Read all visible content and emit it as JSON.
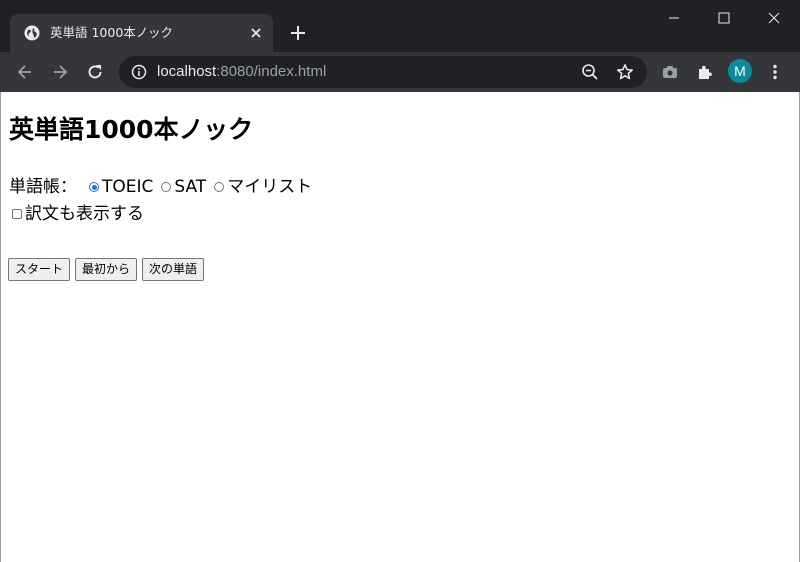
{
  "browser": {
    "tab_title": "英単語 1000本ノック",
    "url_host": "localhost",
    "url_rest": ":8080/index.html",
    "profile_initial": "M"
  },
  "page": {
    "heading": "英単語1000本ノック",
    "vocab_label": "単語帳：",
    "options": [
      {
        "label": "TOEIC",
        "checked": true
      },
      {
        "label": "SAT",
        "checked": false
      },
      {
        "label": "マイリスト",
        "checked": false
      }
    ],
    "show_translation_label": "訳文も表示する",
    "buttons": {
      "start": "スタート",
      "restart": "最初から",
      "next": "次の単語"
    }
  },
  "colors": {
    "chrome_dark": "#202124",
    "chrome_toolbar": "#35363a",
    "radio_accent": "#1a73e8",
    "avatar": "#0a8a9a"
  }
}
